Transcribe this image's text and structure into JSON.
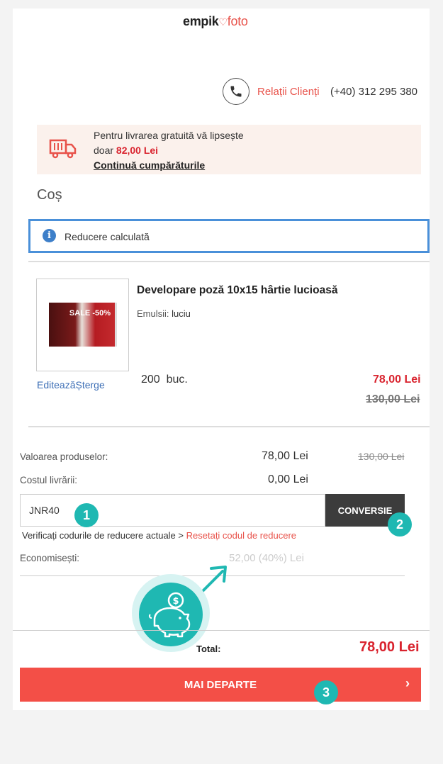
{
  "brand": {
    "name": "empik",
    "sub": "foto"
  },
  "contact": {
    "label": "Relații Clienți",
    "phone": "(+40) 312 295 380"
  },
  "delivery": {
    "line1": "Pentru livrarea gratuită vă lipsește",
    "prefix": "doar",
    "amount": "82,00 Lei",
    "link": "Continuă cumpărăturile"
  },
  "cart": {
    "title": "Coș",
    "notice": "Reducere calculată",
    "item": {
      "thumb_text": "SALE -50%",
      "title": "Developare poză 10x15 hârtie lucioasă",
      "attr_label": "Emulsii:",
      "attr_value": "luciu",
      "edit": "Editează",
      "delete": "Șterge",
      "qty": "200",
      "unit": "buc.",
      "price": "78,00 Lei",
      "old_price": "130,00 Lei"
    }
  },
  "summary": {
    "products_label": "Valoarea produselor:",
    "products_value": "78,00 Lei",
    "products_old": "130,00 Lei",
    "shipping_label": "Costul livrării:",
    "shipping_value": "0,00 Lei",
    "coupon_value": "JNR40",
    "convert_label": "CONVERSIE",
    "verify_text": "Verificați codurile de reducere actuale >",
    "reset_text": "Resetați codul de reducere",
    "savings_label": "Economisești:",
    "savings_value": "52,00 (40%) Lei",
    "total_label": "Total:",
    "total_value": "78,00 Lei",
    "next_label": "MAI DEPARTE",
    "next_icon": "chevron-right-icon"
  },
  "steps": [
    "1",
    "2",
    "3"
  ],
  "colors": {
    "accent": "#e8524a",
    "price": "#d9232e",
    "info": "#4a90d9",
    "teal": "#1fb8b2",
    "button": "#f34f47"
  }
}
